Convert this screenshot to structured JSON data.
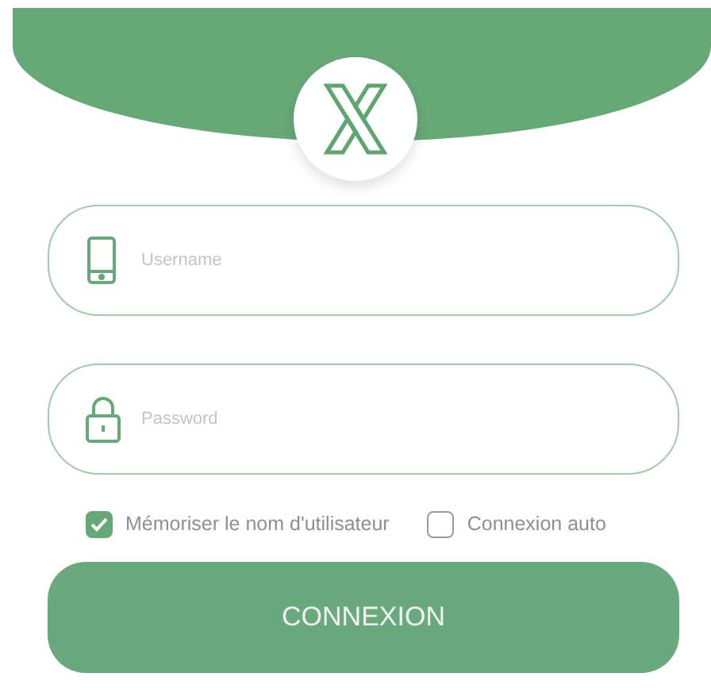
{
  "fields": [
    {
      "kind": "phone",
      "placeholder": "Username"
    },
    {
      "kind": "lock",
      "placeholder": "Password"
    }
  ],
  "options": [
    {
      "label": "Mémoriser le nom d'utilisateur",
      "checked": true
    },
    {
      "label": "Connexion auto",
      "checked": false
    }
  ],
  "login_button": "CONNEXION"
}
